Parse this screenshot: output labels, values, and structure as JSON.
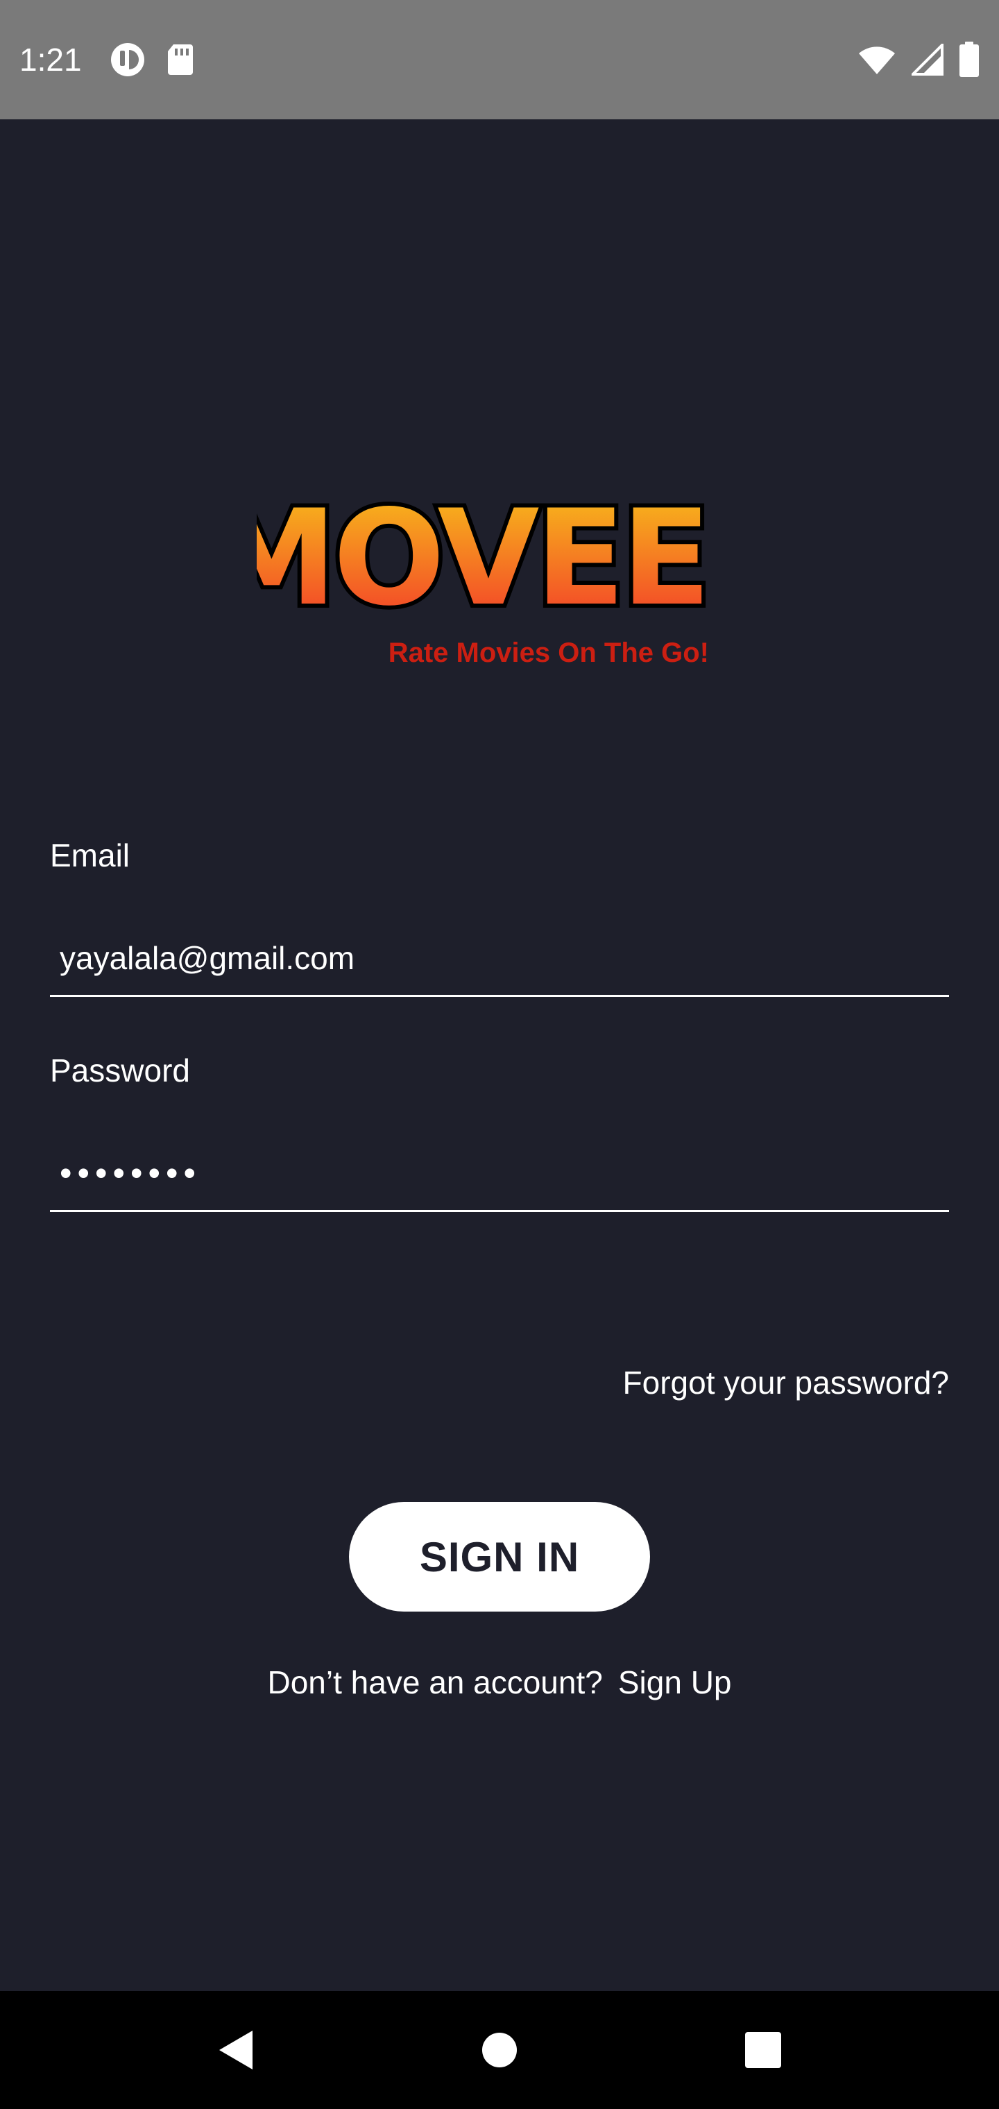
{
  "status_bar": {
    "time": "1:21",
    "left_icons": [
      "media-icon",
      "sd-card-icon"
    ],
    "right_icons": [
      "wifi-icon",
      "signal-icon",
      "battery-icon"
    ]
  },
  "logo": {
    "title": "MOVEE",
    "tagline": "Rate Movies On The Go!",
    "colors": {
      "gradient_top": "#f8c21a",
      "gradient_bottom": "#f2372a",
      "outline": "#000000",
      "tagline": "#cc1f12"
    }
  },
  "form": {
    "email": {
      "label": "Email",
      "value": "yayalala@gmail.com"
    },
    "password": {
      "label": "Password",
      "value": "••••••••"
    }
  },
  "forgot_password": "Forgot your password?",
  "sign_in_button": "SIGN IN",
  "signup": {
    "prompt": "Don’t have an account?",
    "link": "Sign Up"
  },
  "nav_bar": {
    "icons": [
      "back-icon",
      "home-icon",
      "recents-icon"
    ]
  },
  "colors": {
    "background": "#1e1f2b",
    "status_bar": "#7a7a7a",
    "nav_bar": "#000000",
    "text": "#ffffff"
  }
}
